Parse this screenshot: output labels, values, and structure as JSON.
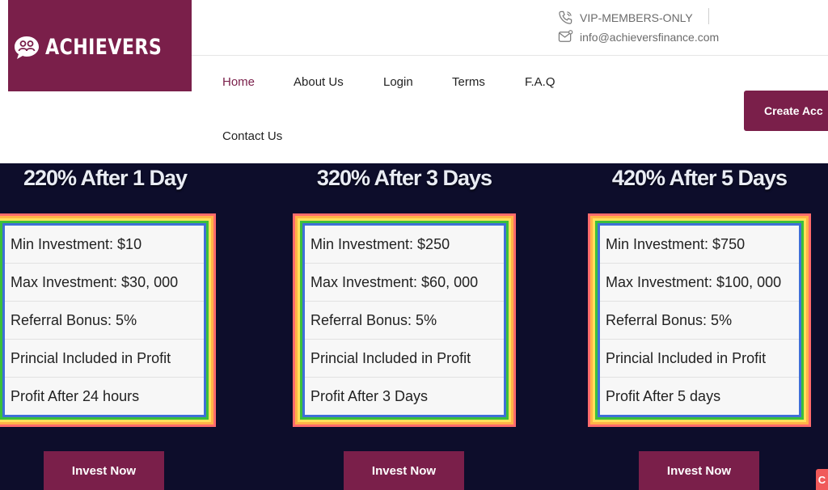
{
  "brand": {
    "name": "ACHIEVERS",
    "accent": "#7a1f4a",
    "dark_bg": "#0d0d2b"
  },
  "contact": {
    "phone_label": "VIP-MEMBERS-ONLY",
    "email": "info@achieversfinance.com",
    "phone_icon": "phone-icon",
    "email_icon": "mail-icon"
  },
  "nav": {
    "home": "Home",
    "about": "About Us",
    "login": "Login",
    "terms": "Terms",
    "faq": "F.A.Q",
    "contact": "Contact Us",
    "active": "Home"
  },
  "cta": {
    "label": "Create Acc"
  },
  "plans": [
    {
      "title": "220% After 1 Day",
      "rows": [
        "Min Investment: $10",
        "Max Investment: $30, 000",
        "Referral Bonus: 5%",
        "Princial Included in Profit",
        "Profit After 24 hours"
      ],
      "button": "Invest Now"
    },
    {
      "title": "320% After 3 Days",
      "rows": [
        "Min Investment: $250",
        "Max Investment: $60, 000",
        "Referral Bonus: 5%",
        "Princial Included in Profit",
        "Profit After 3 Days"
      ],
      "button": "Invest Now"
    },
    {
      "title": "420% After 5 Days",
      "rows": [
        "Min Investment: $750",
        "Max Investment: $100, 000",
        "Referral Bonus: 5%",
        "Princial Included in Profit",
        "Profit After 5 days"
      ],
      "button": "Invest Now"
    }
  ],
  "chat_badge": "C"
}
